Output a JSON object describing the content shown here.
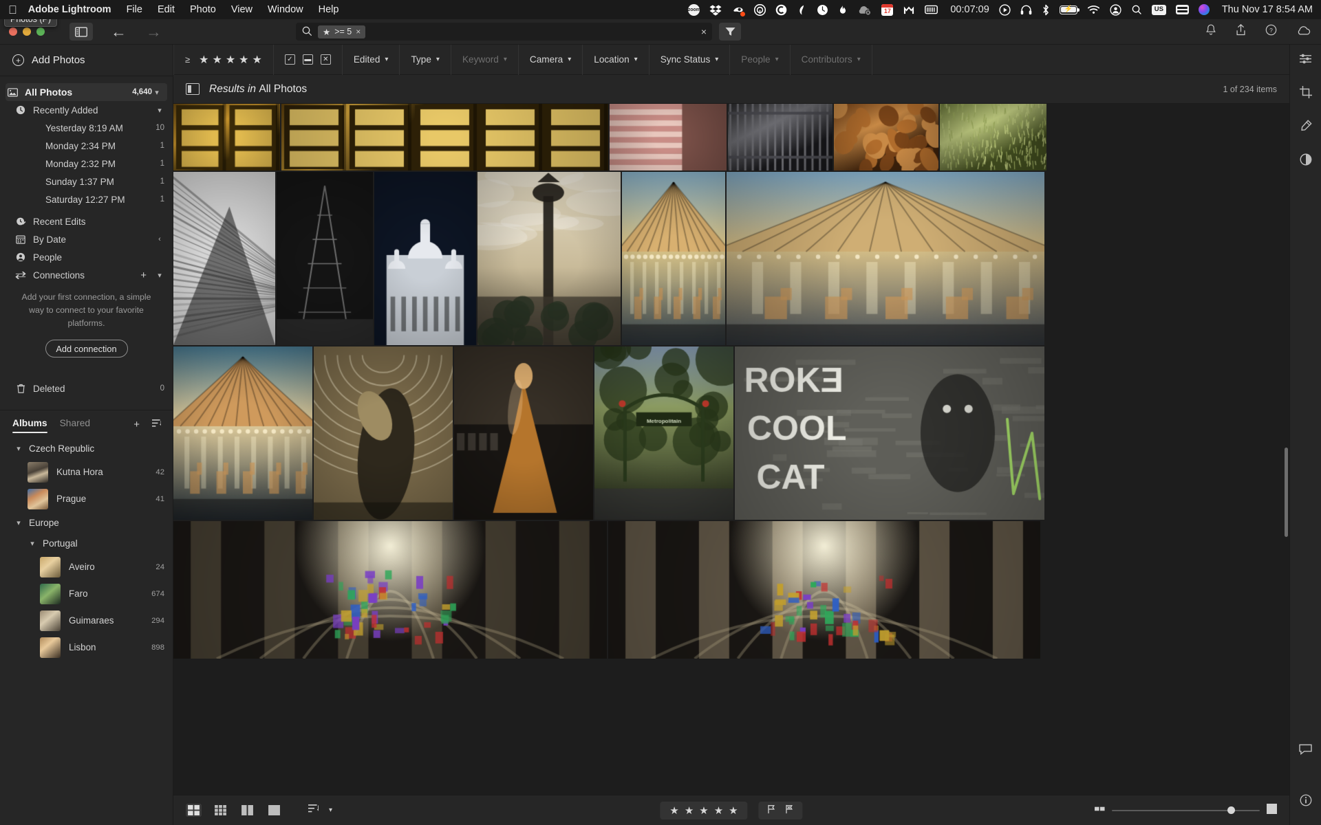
{
  "menubar": {
    "apple_icon": "apple-logo",
    "app_name": "Adobe Lightroom",
    "menus": [
      "File",
      "Edit",
      "Photo",
      "View",
      "Window",
      "Help"
    ],
    "tray_icons": [
      "zoom-icon",
      "dropbox-icon",
      "cleanmymac-icon",
      "1password-icon",
      "adguard-icon",
      "surfshark-icon",
      "timer-icon",
      "flame-icon",
      "cloud-offline-icon",
      "calendar-icon",
      "malwarebytes-icon",
      "battery-meter-icon",
      "play-icon",
      "headphones-icon",
      "bluetooth-icon",
      "battery-icon",
      "wifi-icon",
      "account-icon",
      "spotlight-icon",
      "input-source-icon",
      "control-center-icon",
      "siri-icon"
    ],
    "calendar_day": "17",
    "keyboard_layout": "US",
    "timer_value": "00:07:09",
    "clock": "Thu Nov 17  8:54 AM"
  },
  "titlebar": {
    "tooltip": "Photos (P)",
    "panel_toggle_icon": "panel-layout-icon",
    "back_icon": "arrow-left-icon",
    "forward_icon": "arrow-right-icon",
    "notifications_icon": "bell-icon",
    "share_icon": "share-icon",
    "help_icon": "help-icon",
    "cloud_icon": "cloud-icon"
  },
  "search": {
    "placeholder": "",
    "icon": "search-icon",
    "chip_star": "★",
    "chip_text": ">= 5",
    "chip_remove": "×",
    "clear": "×",
    "filter_icon": "funnel-icon"
  },
  "sidebar": {
    "add_photos": "Add Photos",
    "all_photos": {
      "label": "All Photos",
      "count": "4,640",
      "icon": "photo-icon"
    },
    "recently_added": {
      "label": "Recently Added",
      "icon": "clock-icon"
    },
    "recent_items": [
      {
        "label": "Yesterday 8:19 AM",
        "count": "10"
      },
      {
        "label": "Monday  2:34 PM",
        "count": "1"
      },
      {
        "label": "Monday  2:32 PM",
        "count": "1"
      },
      {
        "label": "Sunday  1:37 PM",
        "count": "1"
      },
      {
        "label": "Saturday  12:27 PM",
        "count": "1"
      }
    ],
    "nav": [
      {
        "label": "Recent Edits",
        "icon": "recent-edits-icon"
      },
      {
        "label": "By Date",
        "icon": "calendar-icon"
      },
      {
        "label": "People",
        "icon": "person-icon"
      },
      {
        "label": "Connections",
        "icon": "connections-icon"
      }
    ],
    "connections_note": "Add your first connection, a simple way to connect to your favorite platforms.",
    "add_connection": "Add connection",
    "deleted": {
      "label": "Deleted",
      "count": "0",
      "icon": "trash-icon"
    },
    "albums_tabs": {
      "albums": "Albums",
      "shared": "Shared"
    },
    "albums_add_icon": "plus-icon",
    "albums_sort_icon": "sort-icon",
    "groups": [
      {
        "name": "Czech Republic",
        "albums": [
          {
            "name": "Kutna Hora",
            "count": "42"
          },
          {
            "name": "Prague",
            "count": "41"
          }
        ]
      },
      {
        "name": "Europe",
        "subgroups": [
          {
            "name": "Portugal",
            "albums": [
              {
                "name": "Aveiro",
                "count": "24"
              },
              {
                "name": "Faro",
                "count": "674"
              },
              {
                "name": "Guimaraes",
                "count": "294"
              },
              {
                "name": "Lisbon",
                "count": "898"
              }
            ]
          }
        ]
      }
    ]
  },
  "filterbar": {
    "rating_operator": "≥",
    "stars": 5,
    "flags": [
      "flag-picked-icon",
      "flag-unflagged-icon",
      "flag-rejected-icon"
    ],
    "dropdowns": [
      {
        "label": "Edited",
        "dimmed": false
      },
      {
        "label": "Type",
        "dimmed": false
      },
      {
        "label": "Keyword",
        "dimmed": true
      },
      {
        "label": "Camera",
        "dimmed": false
      },
      {
        "label": "Location",
        "dimmed": false
      },
      {
        "label": "Sync Status",
        "dimmed": false
      },
      {
        "label": "People",
        "dimmed": true
      },
      {
        "label": "Contributors",
        "dimmed": true
      }
    ]
  },
  "results": {
    "grid_icon": "grid-view-icon",
    "title_prefix": "Results in ",
    "title_scope": "All Photos",
    "count": "1 of 234 items"
  },
  "bottombar": {
    "view_modes": [
      "grid-view-icon",
      "compact-grid-icon",
      "compare-view-icon",
      "detail-view-icon"
    ],
    "sort_icon": "sort-icon",
    "sort_caret": "chevron-down-icon",
    "rating_stars": "★★★★★",
    "flag_pick_icon": "flag-picked-icon",
    "flag_reject_icon": "flag-rejected-icon",
    "zoom_out_icon": "zoom-out-icon",
    "zoom_in_icon": "zoom-in-icon"
  },
  "rail": {
    "icons": [
      "edit-sliders-icon",
      "crop-icon",
      "healing-brush-icon",
      "masking-icon",
      "comments-icon",
      "info-icon"
    ]
  },
  "photos": [
    {
      "row": 0,
      "name": "golden-doors-left",
      "palette": [
        "#6b4a10",
        "#c9952c",
        "#3a2a08",
        "#e0b94e"
      ],
      "kind": "doors"
    },
    {
      "row": 0,
      "name": "golden-doors-wide",
      "palette": [
        "#5c3f0d",
        "#d0a23a",
        "#2e2107",
        "#e8c867"
      ],
      "kind": "doors"
    },
    {
      "row": 0,
      "name": "pink-stairs",
      "palette": [
        "#c98d86",
        "#e8c7bd",
        "#7a5048",
        "#d9a9a0"
      ],
      "kind": "stairs"
    },
    {
      "row": 0,
      "name": "iron-railing",
      "palette": [
        "#2a2a2c",
        "#6b6b70",
        "#17171a",
        "#49494f"
      ],
      "kind": "rail"
    },
    {
      "row": 0,
      "name": "roasted-chestnuts",
      "palette": [
        "#7a4418",
        "#c98a46",
        "#3d210b",
        "#b06c2c"
      ],
      "kind": "food"
    },
    {
      "row": 0,
      "name": "green-grass-path",
      "palette": [
        "#6d7a3c",
        "#b9c47c",
        "#3f4a1e",
        "#95a35a"
      ],
      "kind": "grass"
    },
    {
      "row": 1,
      "name": "bw-perspective-stairs",
      "palette": [
        "#cfcfcf",
        "#8e8e8e",
        "#3a3a3a",
        "#efefef"
      ],
      "kind": "bw"
    },
    {
      "row": 1,
      "name": "eiffel-tower-bw",
      "palette": [
        "#1a1a1a",
        "#4a4a4a",
        "#0d0d0d",
        "#777777"
      ],
      "kind": "bwtower"
    },
    {
      "row": 1,
      "name": "sacre-coeur-night",
      "palette": [
        "#0d1524",
        "#c9cfd6",
        "#1d2a40",
        "#e6e9ee"
      ],
      "kind": "basilica"
    },
    {
      "row": 1,
      "name": "paris-lamp-skyline",
      "palette": [
        "#c9bb9a",
        "#e5dcc4",
        "#5a523f",
        "#8a8068"
      ],
      "kind": "lamp"
    },
    {
      "row": 1,
      "name": "carousel-horses",
      "palette": [
        "#8ab4cc",
        "#e0c98a",
        "#3e4e5a",
        "#d8b070"
      ],
      "kind": "carousel"
    },
    {
      "row": 1,
      "name": "carousel-sacre-coeur",
      "palette": [
        "#7fa8c4",
        "#dcc48a",
        "#47505a",
        "#cfae74"
      ],
      "kind": "carousel"
    },
    {
      "row": 2,
      "name": "carousel-closeup",
      "palette": [
        "#4a7c94",
        "#e8d3a0",
        "#24313b",
        "#cf9a5c"
      ],
      "kind": "carousel"
    },
    {
      "row": 2,
      "name": "orsay-sculpture",
      "palette": [
        "#7a6a4a",
        "#cbb98c",
        "#2e281c",
        "#9e8c62"
      ],
      "kind": "museum"
    },
    {
      "row": 2,
      "name": "degas-dancer",
      "palette": [
        "#b5752c",
        "#e0b071",
        "#1d1a17",
        "#7d4f1c"
      ],
      "kind": "statue"
    },
    {
      "row": 2,
      "name": "metropolitain-sign",
      "palette": [
        "#3f4a2c",
        "#8a9a60",
        "#1b2013",
        "#6a7a44"
      ],
      "kind": "street"
    },
    {
      "row": 2,
      "name": "roke-cool-cat-graffiti",
      "palette": [
        "#6a6a64",
        "#b9b9ae",
        "#3a3a36",
        "#8f8f86"
      ],
      "kind": "graffiti"
    },
    {
      "row": 3,
      "name": "cathedral-stained-glass",
      "palette": [
        "#2b2a26",
        "#6a5f48",
        "#121110",
        "#3f6ea8"
      ],
      "kind": "cathedral"
    },
    {
      "row": 3,
      "name": "cathedral-nave",
      "palette": [
        "#4a4238",
        "#9a8a70",
        "#1c1915",
        "#c9b494"
      ],
      "kind": "cathedral"
    }
  ]
}
